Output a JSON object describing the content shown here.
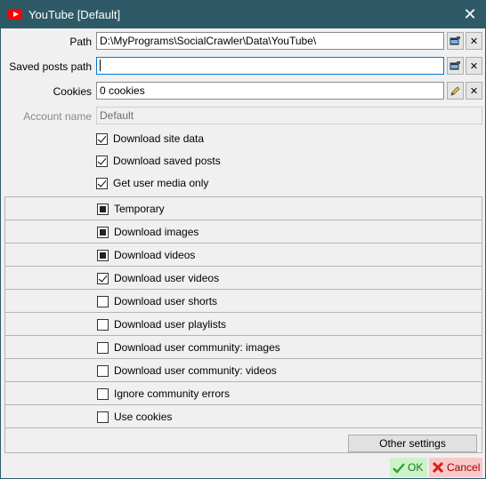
{
  "window": {
    "title": "YouTube [Default]",
    "close_glyph": "✕",
    "icon": "youtube-icon"
  },
  "form": {
    "path": {
      "label": "Path",
      "value": "D:\\MyPrograms\\SocialCrawler\\Data\\YouTube\\"
    },
    "saved_posts_path": {
      "label": "Saved posts path",
      "value": ""
    },
    "cookies": {
      "label": "Cookies",
      "value": "0 cookies"
    },
    "account_name": {
      "label": "Account name",
      "value": "Default"
    }
  },
  "options": {
    "download_site_data": {
      "label": "Download site data",
      "checked": true
    },
    "download_saved_posts": {
      "label": "Download saved posts",
      "checked": true
    },
    "get_user_media_only": {
      "label": "Get user media only",
      "checked": true
    }
  },
  "settings_rows": [
    {
      "label": "Temporary",
      "state": "indeterminate"
    },
    {
      "label": "Download images",
      "state": "indeterminate"
    },
    {
      "label": "Download videos",
      "state": "indeterminate"
    },
    {
      "label": "Download user videos",
      "state": "checked"
    },
    {
      "label": "Download user shorts",
      "state": "unchecked"
    },
    {
      "label": "Download user playlists",
      "state": "unchecked"
    },
    {
      "label": "Download user community: images",
      "state": "unchecked"
    },
    {
      "label": "Download user community: videos",
      "state": "unchecked"
    },
    {
      "label": "Ignore community errors",
      "state": "unchecked"
    },
    {
      "label": "Use cookies",
      "state": "unchecked"
    }
  ],
  "buttons": {
    "other_settings": "Other settings",
    "ok": "OK",
    "cancel": "Cancel"
  },
  "colors": {
    "titlebar": "#2e5a68",
    "ok_bg": "#cdf2c9",
    "cancel_bg": "#f8c9c9",
    "focus": "#0078d7"
  }
}
